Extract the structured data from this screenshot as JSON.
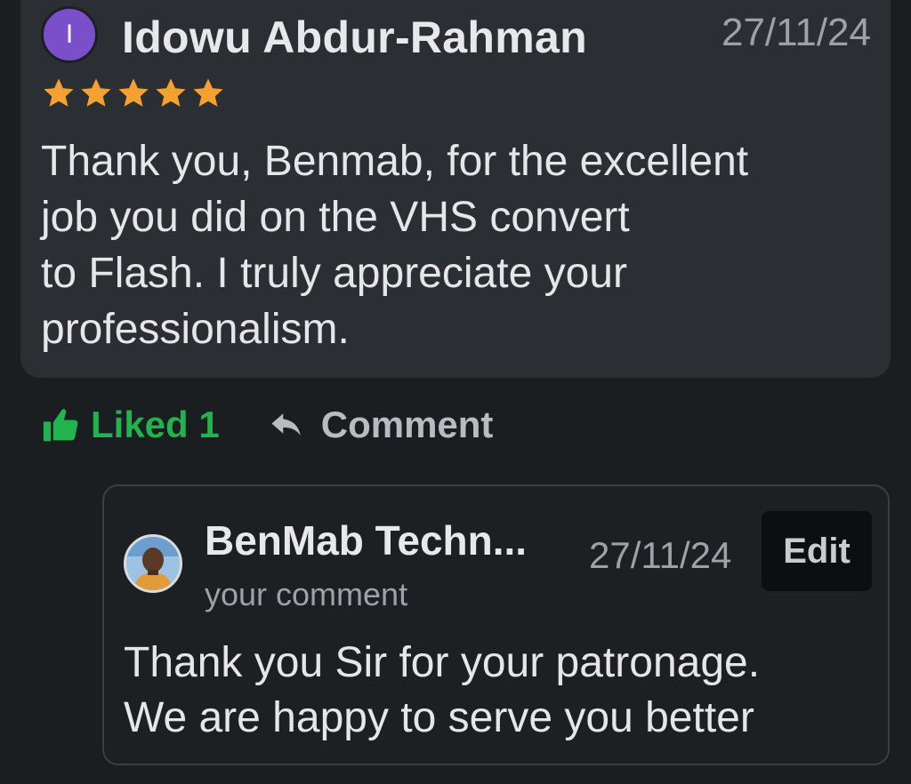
{
  "review": {
    "avatar_initial": "I",
    "reviewer_name": "Idowu Abdur-Rahman",
    "date": "27/11/24",
    "rating": 5,
    "rating_max": 5,
    "star_color": "#f4a131",
    "text": "Thank you, Benmab, for the excellent\njob you did on the VHS convert\nto Flash. I truly appreciate your\nprofessionalism."
  },
  "actions": {
    "like_label": "Liked 1",
    "like_color": "#21b34d",
    "like_icon": "thumbs-up-icon",
    "comment_label": "Comment",
    "comment_icon": "reply-arrow-icon"
  },
  "reply": {
    "author_name": "BenMab Techn...",
    "date": "27/11/24",
    "edit_label": "Edit",
    "subtitle": "your comment",
    "text": "Thank you Sir for your patronage.\nWe are happy to serve you better"
  }
}
